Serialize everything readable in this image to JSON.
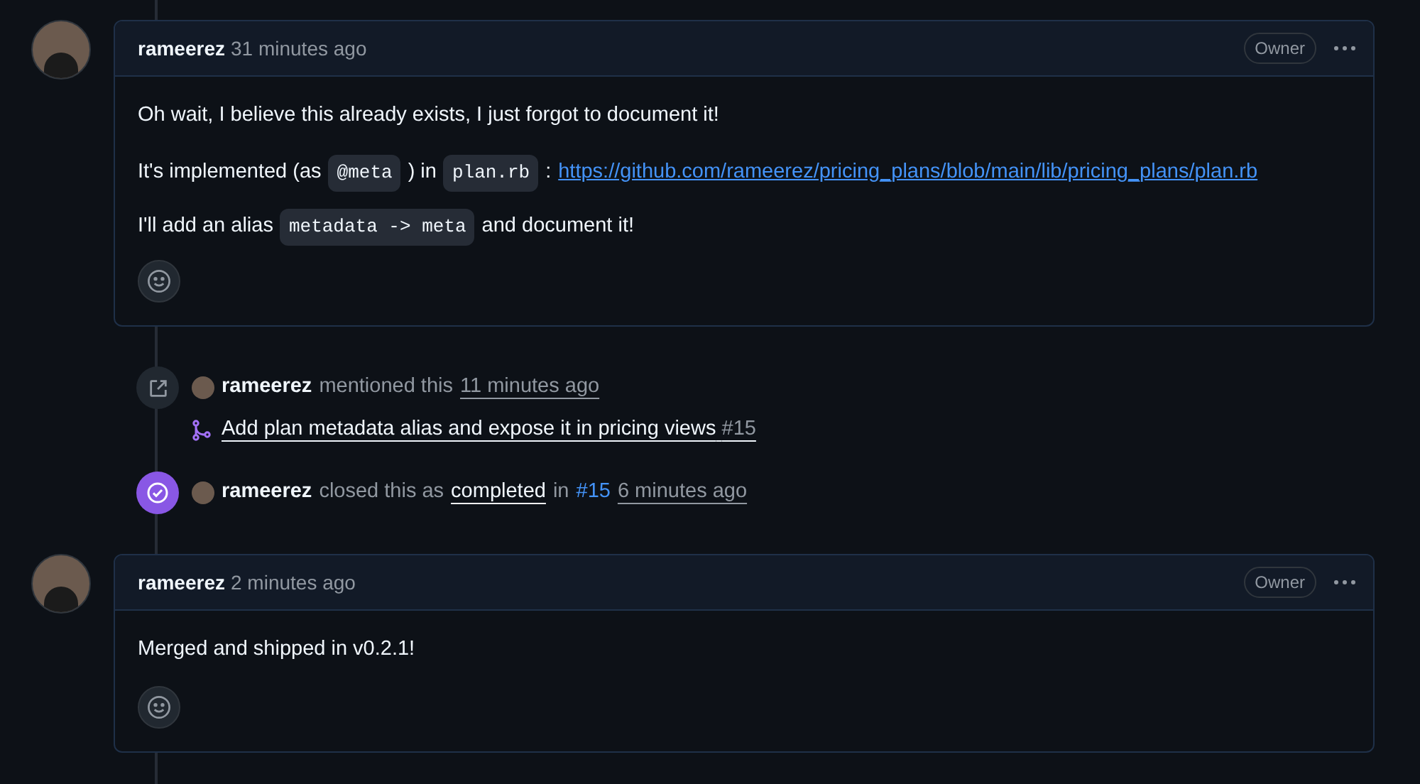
{
  "comments": [
    {
      "author": "rameerez",
      "time": "31 minutes ago",
      "badge": "Owner",
      "paragraphs": [
        [
          {
            "kind": "text",
            "text": "Oh wait, I believe this already exists, I just forgot to document it!"
          }
        ],
        [
          {
            "kind": "text",
            "text": "It's implemented (as"
          },
          {
            "kind": "code",
            "text": "@meta"
          },
          {
            "kind": "text",
            "text": ") in"
          },
          {
            "kind": "code",
            "text": "plan.rb"
          },
          {
            "kind": "text",
            "text": ":"
          },
          {
            "kind": "link",
            "text": "https://github.com/rameerez/pricing_plans/blob/main/lib/pricing_plans/plan.rb"
          }
        ],
        [
          {
            "kind": "text",
            "text": "I'll add an alias"
          },
          {
            "kind": "code",
            "text": "metadata -> meta"
          },
          {
            "kind": "text",
            "text": "and document it!"
          }
        ]
      ]
    }
  ],
  "events": [
    {
      "kind": "mention",
      "actor": "rameerez",
      "parts": [
        {
          "kind": "muted",
          "text": "mentioned this"
        },
        {
          "kind": "time",
          "text": "11 minutes ago"
        }
      ],
      "pull_request": {
        "title": "Add plan metadata alias and expose it in pricing views",
        "number": "#15"
      }
    },
    {
      "kind": "closed",
      "actor": "rameerez",
      "parts": [
        {
          "kind": "muted",
          "text": "closed this as"
        },
        {
          "kind": "link",
          "text": "completed"
        },
        {
          "kind": "muted",
          "text": "in"
        },
        {
          "kind": "ref",
          "text": "#15"
        },
        {
          "kind": "time",
          "text": "6 minutes ago"
        }
      ]
    }
  ],
  "later_comments": [
    {
      "author": "rameerez",
      "time": "2 minutes ago",
      "badge": "Owner",
      "paragraphs": [
        [
          {
            "kind": "text",
            "text": "Merged and shipped in v0.2.1!"
          }
        ]
      ]
    }
  ]
}
